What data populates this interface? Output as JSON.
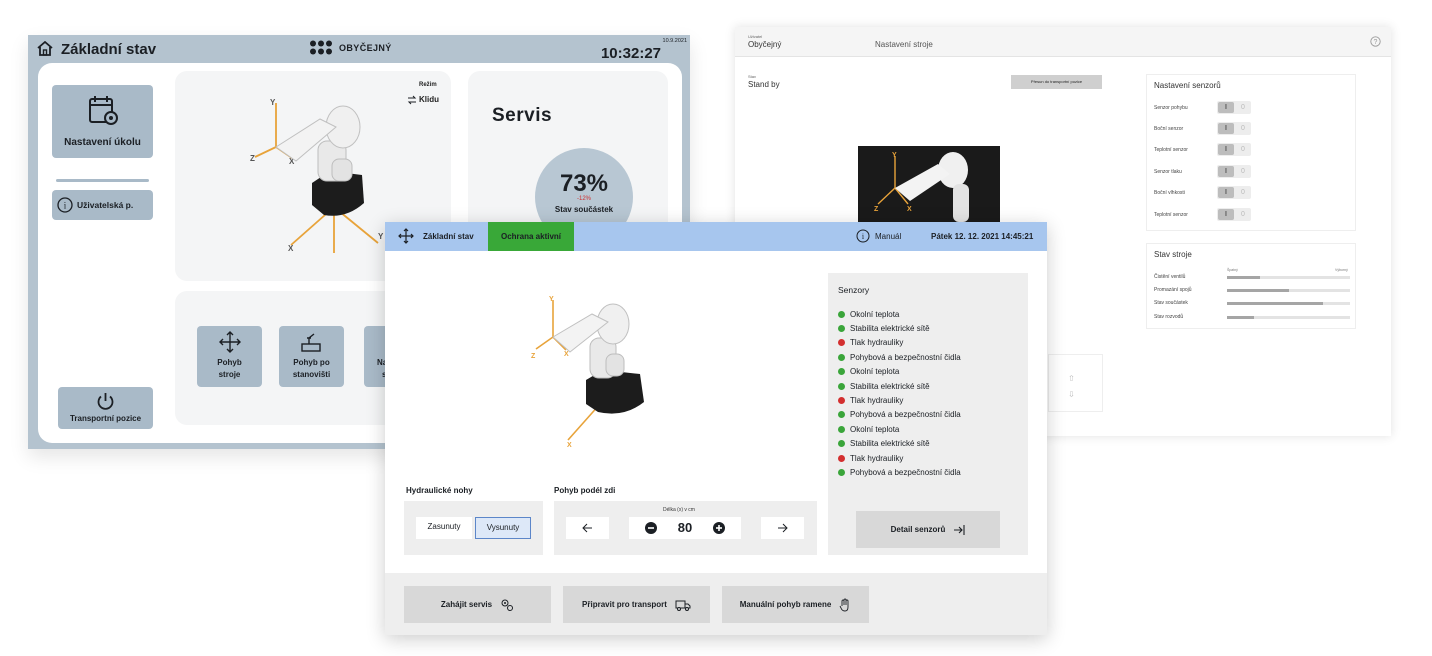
{
  "left_screen": {
    "title": "Základní stav",
    "mode": "OBYČEJNÝ",
    "date": "10.9.2021",
    "time": "10:32:27",
    "task_button": "Nastavení úkolu",
    "user_button": "Uživatelská p.",
    "transport_button": "Transportní pozice",
    "regime_label": "Režim",
    "regime_value": "Klidu",
    "service_title": "Servis",
    "service_percent": "73%",
    "service_delta": "-12%",
    "service_label": "Stav součástek",
    "actions": [
      {
        "line1": "Pohyb",
        "line2": "stroje"
      },
      {
        "line1": "Pohyb po",
        "line2": "stanovišti"
      },
      {
        "line1": "Na",
        "line2": "s"
      }
    ]
  },
  "right_screen": {
    "mode_small": "Uživatel",
    "mode": "Obyčejný",
    "title": "Nastavení stroje",
    "state_small": "Stav",
    "state": "Stand by",
    "transport_button": "Přesun do transportní pozice",
    "sensor_settings": {
      "title": "Nastavení senzorů",
      "on_label": "I",
      "off_label": "0",
      "items": [
        "Senzor pohybu",
        "Boční senzor",
        "Teplotní senzor",
        "Senzor tlaku",
        "Boční vlhkosti",
        "Teplotní senzor"
      ]
    },
    "machine_state": {
      "title": "Stav stroje",
      "scale_low": "Špatný",
      "scale_high": "Výborný",
      "items": [
        {
          "label": "Čistění ventilů",
          "value": 0.27
        },
        {
          "label": "Promazání spojů",
          "value": 0.5
        },
        {
          "label": "Stav součástek",
          "value": 0.78
        },
        {
          "label": "Stav rozvodů",
          "value": 0.22
        }
      ]
    }
  },
  "front_screen": {
    "nav_title": "Základní stav",
    "protection": "Ochrana aktivní",
    "mode": "Manuál",
    "datetime": "Pátek 12. 12. 2021 14:45:21",
    "sensors_title": "Senzory",
    "sensors": [
      {
        "label": "Okolní teplota",
        "status": "ok"
      },
      {
        "label": "Stabilita elektrické sítě",
        "status": "ok"
      },
      {
        "label": "Tlak hydrauliky",
        "status": "error"
      },
      {
        "label": "Pohybová a bezpečnostní čidla",
        "status": "ok"
      },
      {
        "label": "Okolní teplota",
        "status": "ok"
      },
      {
        "label": "Stabilita elektrické sítě",
        "status": "ok"
      },
      {
        "label": "Tlak hydrauliky",
        "status": "error"
      },
      {
        "label": "Pohybová a bezpečnostní čidla",
        "status": "ok"
      },
      {
        "label": "Okolní teplota",
        "status": "ok"
      },
      {
        "label": "Stabilita elektrické sítě",
        "status": "ok"
      },
      {
        "label": "Tlak hydrauliky",
        "status": "error"
      },
      {
        "label": "Pohybová a bezpečnostní čidla",
        "status": "ok"
      }
    ],
    "status_colors": {
      "ok": "#3aa53a",
      "error": "#d32f2f"
    },
    "sensor_detail_button": "Detail senzorů",
    "hydraulic_label": "Hydraulické nohy",
    "hydraulic_retracted": "Zasunuty",
    "hydraulic_extended": "Vysunuty",
    "wall_move_label": "Pohyb podél zdi",
    "length_label": "Délka (x) v cm",
    "length_value": "80",
    "buttons": {
      "service": "Zahájit servis",
      "transport": "Připravit pro transport",
      "manual_arm": "Manuální pohyb ramene"
    }
  },
  "robot_axes": [
    "Y",
    "X",
    "Z",
    "Z",
    "X",
    "Y"
  ],
  "colors": {
    "left_header": "#b4c3cf",
    "left_card": "#a9bac8",
    "front_nav": "#a7c6ee",
    "protection_green": "#39a838",
    "axis_orange": "#e8a33a"
  }
}
